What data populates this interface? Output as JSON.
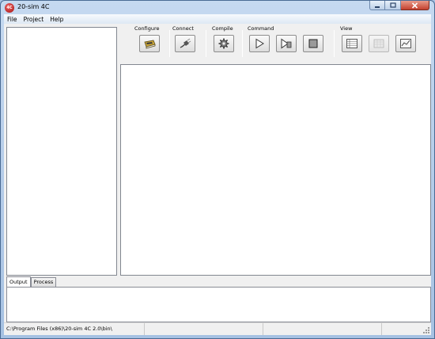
{
  "window": {
    "title": "20-sim 4C",
    "icon": "20sim-app-icon"
  },
  "menu": [
    {
      "label": "File"
    },
    {
      "label": "Project"
    },
    {
      "label": "Help"
    }
  ],
  "toolbar": {
    "groups": [
      {
        "label": "Configure",
        "buttons": [
          {
            "icon": "configure-chip-icon",
            "enabled": true
          }
        ]
      },
      {
        "label": "Connect",
        "buttons": [
          {
            "icon": "connect-plug-icon",
            "enabled": true
          }
        ]
      },
      {
        "label": "Compile",
        "buttons": [
          {
            "icon": "compile-gear-icon",
            "enabled": true
          }
        ]
      },
      {
        "label": "Command",
        "buttons": [
          {
            "icon": "run-icon",
            "enabled": true
          },
          {
            "icon": "step-icon",
            "enabled": true
          },
          {
            "icon": "stop-icon",
            "enabled": true
          }
        ]
      },
      {
        "label": "View",
        "buttons": [
          {
            "icon": "variables-view-icon",
            "enabled": true
          },
          {
            "icon": "grid-view-icon",
            "enabled": false
          },
          {
            "icon": "plot-view-icon",
            "enabled": true
          }
        ]
      }
    ]
  },
  "bottom_tabs": [
    {
      "label": "Output",
      "active": true
    },
    {
      "label": "Process",
      "active": false
    }
  ],
  "status": {
    "path": "C:\\Program Files (x86)\\20-sim 4C 2.0\\bin\\"
  }
}
